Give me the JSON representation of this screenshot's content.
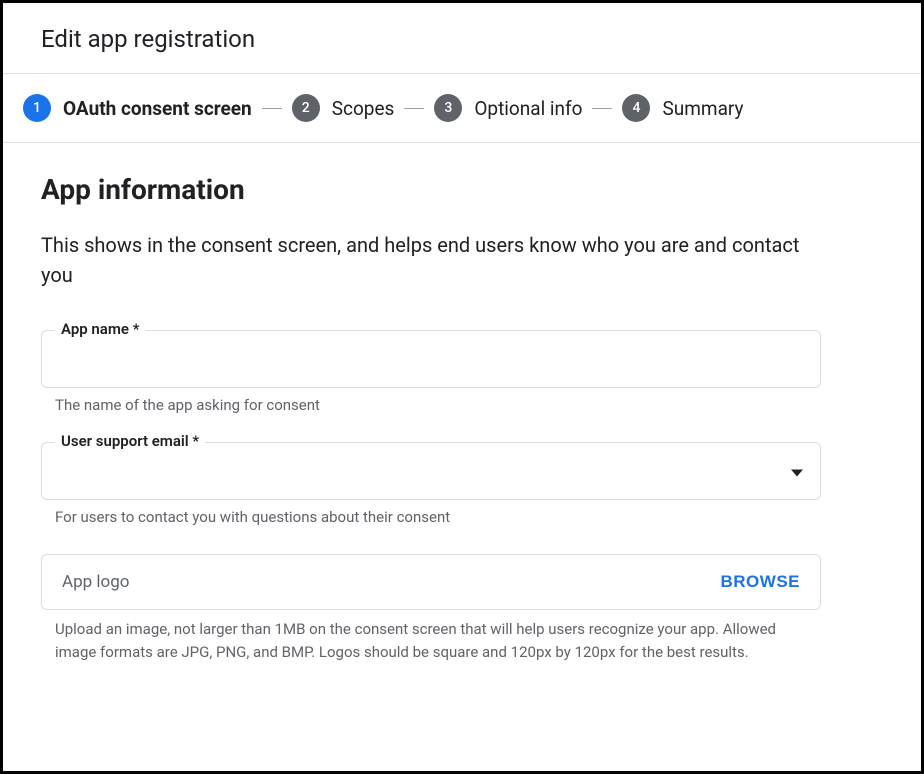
{
  "page": {
    "title": "Edit app registration"
  },
  "stepper": {
    "steps": [
      {
        "num": "1",
        "label": "OAuth consent screen",
        "active": true
      },
      {
        "num": "2",
        "label": "Scopes",
        "active": false
      },
      {
        "num": "3",
        "label": "Optional info",
        "active": false
      },
      {
        "num": "4",
        "label": "Summary",
        "active": false
      }
    ]
  },
  "section": {
    "title": "App information",
    "desc": "This shows in the consent screen, and helps end users know who you are and contact you"
  },
  "fields": {
    "app_name": {
      "label": "App name *",
      "value": "",
      "helper": "The name of the app asking for consent"
    },
    "support_email": {
      "label": "User support email *",
      "value": "",
      "helper": "For users to contact you with questions about their consent"
    },
    "logo": {
      "label": "App logo",
      "browse": "BROWSE",
      "helper": "Upload an image, not larger than 1MB on the consent screen that will help users recognize your app. Allowed image formats are JPG, PNG, and BMP. Logos should be square and 120px by 120px for the best results."
    }
  }
}
